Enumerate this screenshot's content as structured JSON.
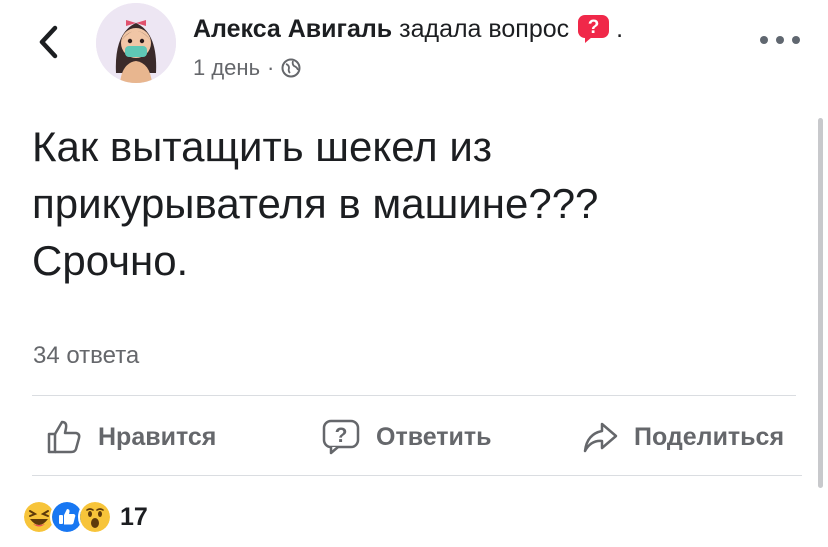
{
  "header": {
    "author_name": "Алекса Авигаль",
    "action_text": "задала вопрос",
    "trailing_dot": ".",
    "time": "1 день",
    "separator": "·",
    "icons": {
      "back": "chevron-left-icon",
      "question": "question-badge-icon",
      "audience": "globe-icon",
      "more": "more-dots-icon"
    },
    "question_badge_color": "#f02849"
  },
  "post": {
    "text": "Как вытащить шекел из прикурывателя в машине??? Срочно.",
    "answers_count": "34 ответа"
  },
  "actions": {
    "like": "Нравится",
    "reply": "Ответить",
    "share": "Поделиться"
  },
  "reactions": {
    "count": "17",
    "types": [
      "haha-icon",
      "like-icon",
      "wow-icon"
    ],
    "like_color": "#1877f2"
  }
}
